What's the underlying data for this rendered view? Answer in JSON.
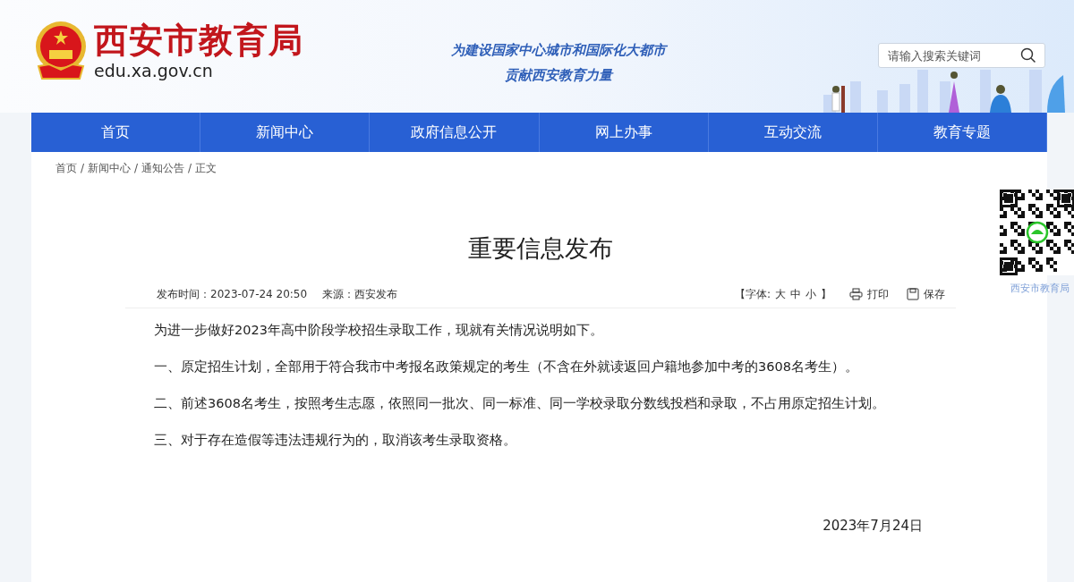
{
  "site": {
    "title": "西安市教育局",
    "domain": "edu.xa.gov.cn",
    "slogan": [
      "为建设国家中心城市和国际化大都市",
      "贡献西安教育力量"
    ]
  },
  "search": {
    "placeholder": "请输入搜索关键词"
  },
  "nav": [
    {
      "label": "首页"
    },
    {
      "label": "新闻中心"
    },
    {
      "label": "政府信息公开"
    },
    {
      "label": "网上办事"
    },
    {
      "label": "互动交流"
    },
    {
      "label": "教育专题"
    }
  ],
  "breadcrumb": [
    {
      "label": "首页",
      "sep": "/"
    },
    {
      "label": "新闻中心",
      "sep": "/"
    },
    {
      "label": "通知公告",
      "sep": "/"
    },
    {
      "label": "正文"
    }
  ],
  "article": {
    "title": "重要信息发布",
    "published": "发布时间：2023-07-24 20:50",
    "source": "来源：西安发布",
    "font_label": "【字体:",
    "font_sizes": [
      "大",
      "中",
      "小"
    ],
    "font_close": "】",
    "print": "打印",
    "save": "保存",
    "paragraphs": [
      "为进一步做好2023年高中阶段学校招生录取工作，现就有关情况说明如下。",
      "一、原定招生计划，全部用于符合我市中考报名政策规定的考生（不含在外就读返回户籍地参加中考的3608名考生）。",
      "二、前述3608名考生，按照考生志愿，依照同一批次、同一标准、同一学校录取分数线投档和录取，不占用原定招生计划。",
      "三、对于存在造假等违法违规行为的，取消该考生录取资格。"
    ],
    "date": "2023年7月24日"
  },
  "qr": {
    "caption": "西安市教育局"
  }
}
